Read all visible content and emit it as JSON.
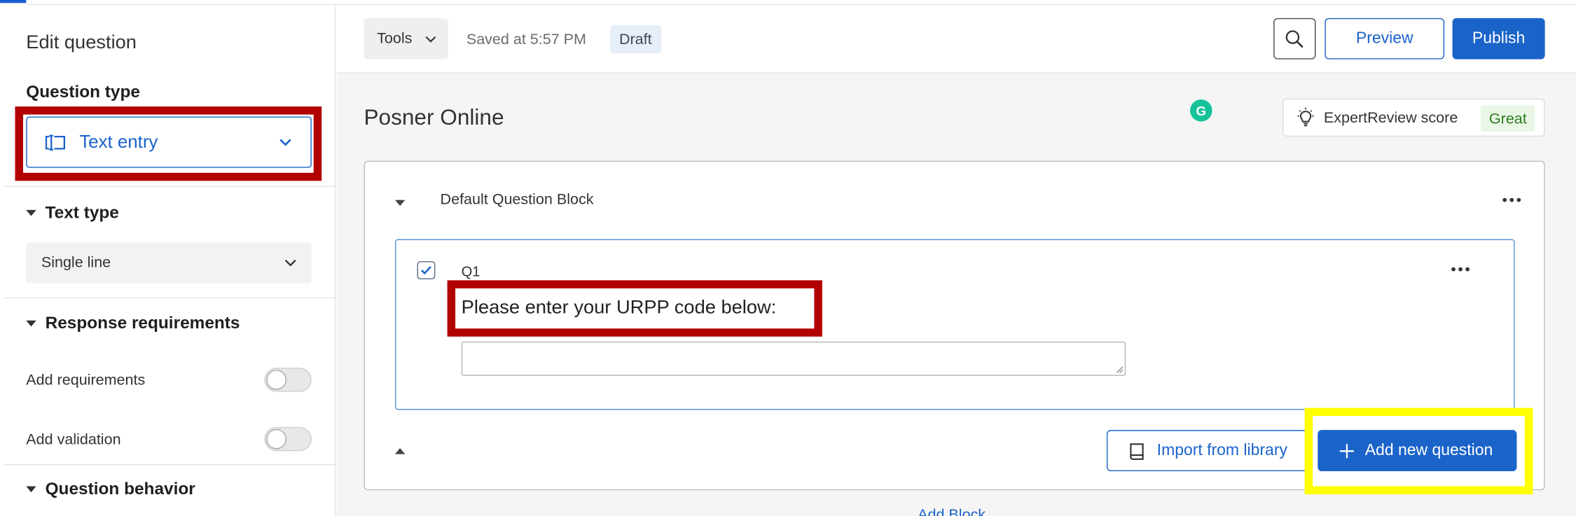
{
  "left_panel": {
    "title": "Edit question",
    "question_type_label": "Question type",
    "question_type_value": "Text entry",
    "text_type_label": "Text type",
    "text_type_value": "Single line",
    "response_requirements_label": "Response requirements",
    "add_requirements_label": "Add requirements",
    "add_requirements_on": false,
    "add_validation_label": "Add validation",
    "add_validation_on": false,
    "question_behavior_label": "Question behavior"
  },
  "toolbar": {
    "tools_label": "Tools",
    "saved_text": "Saved at 5:57 PM",
    "status_badge": "Draft",
    "preview_label": "Preview",
    "publish_label": "Publish"
  },
  "survey": {
    "title": "Posner Online",
    "expert_review_label": "ExpertReview score",
    "expert_review_score": "Great",
    "block_name": "Default Question Block",
    "question": {
      "number": "Q1",
      "checked": true,
      "text": "Please enter your URPP code below:",
      "answer_value": ""
    },
    "import_label": "Import from library",
    "add_question_label": "Add new question",
    "add_block_label": "Add Block"
  },
  "colors": {
    "accent": "#1a63c9",
    "highlight_red": "#b20000",
    "highlight_yellow": "#ffff00",
    "great_green": "#2e7d1f"
  }
}
